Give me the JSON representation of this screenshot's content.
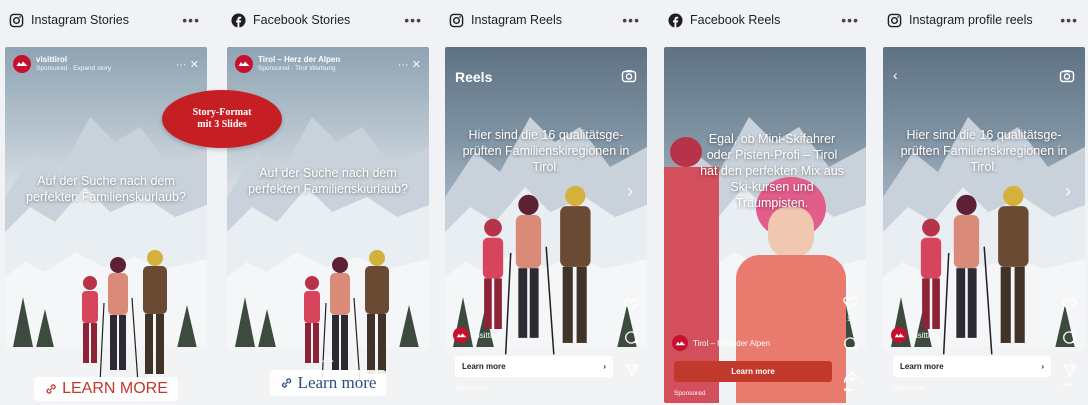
{
  "columns": [
    {
      "icon": "instagram-icon",
      "title": "Instagram Stories",
      "more": "•••"
    },
    {
      "icon": "facebook-icon",
      "title": "Facebook Stories",
      "more": "•••"
    },
    {
      "icon": "instagram-icon",
      "title": "Instagram Reels",
      "more": "•••"
    },
    {
      "icon": "facebook-icon",
      "title": "Facebook Reels",
      "more": "•••"
    },
    {
      "icon": "instagram-icon",
      "title": "Instagram profile reels",
      "more": "•••"
    }
  ],
  "ig_story": {
    "profile_name": "visittirol",
    "profile_sub": "Sponsored · Expand story",
    "controls": "··· ✕",
    "text": "Auf der Suche nach dem perfekten Familienskiurlaub?",
    "cta": "LEARN MORE"
  },
  "fb_story": {
    "profile_name": "Tirol – Herz der Alpen",
    "profile_sub": "Sponsored · Tirol Werbung",
    "controls": "··· ✕",
    "text": "Auf der Suche nach dem perfekten Familienskiurlaub?",
    "cta": "Learn more"
  },
  "badge": {
    "line1": "Story-Format",
    "line2": "mit 3 Slides"
  },
  "ig_reel": {
    "title": "Reels",
    "text": "Hier sind die 16 qualitätsge-prüften Familienskiregionen in Tirol.",
    "profile": "visittirol",
    "cta": "Learn more",
    "sponsored": "Sponsored"
  },
  "fb_reel": {
    "text": "Egal, ob Mini-Skifahrer oder Pisten-Profi – Tirol hat den perfekten Mix aus Ski-kursen und Traumpisten.",
    "profile": "Tirol – Herz der Alpen",
    "cta": "Learn more",
    "sponsored": "Sponsored",
    "like_count": "10",
    "dots": "•••"
  },
  "ig_profile_reel": {
    "text": "Hier sind die 16 qualitätsge-prüften Familienskiregionen in Tirol.",
    "profile": "visittirol",
    "cta": "Learn more",
    "sponsored": "Sponsored",
    "dots": "•••"
  },
  "colors": {
    "brand_red": "#c8102e",
    "badge_red": "#c51f24",
    "cta_red": "#c0392b",
    "background": "#f0f2f5"
  }
}
